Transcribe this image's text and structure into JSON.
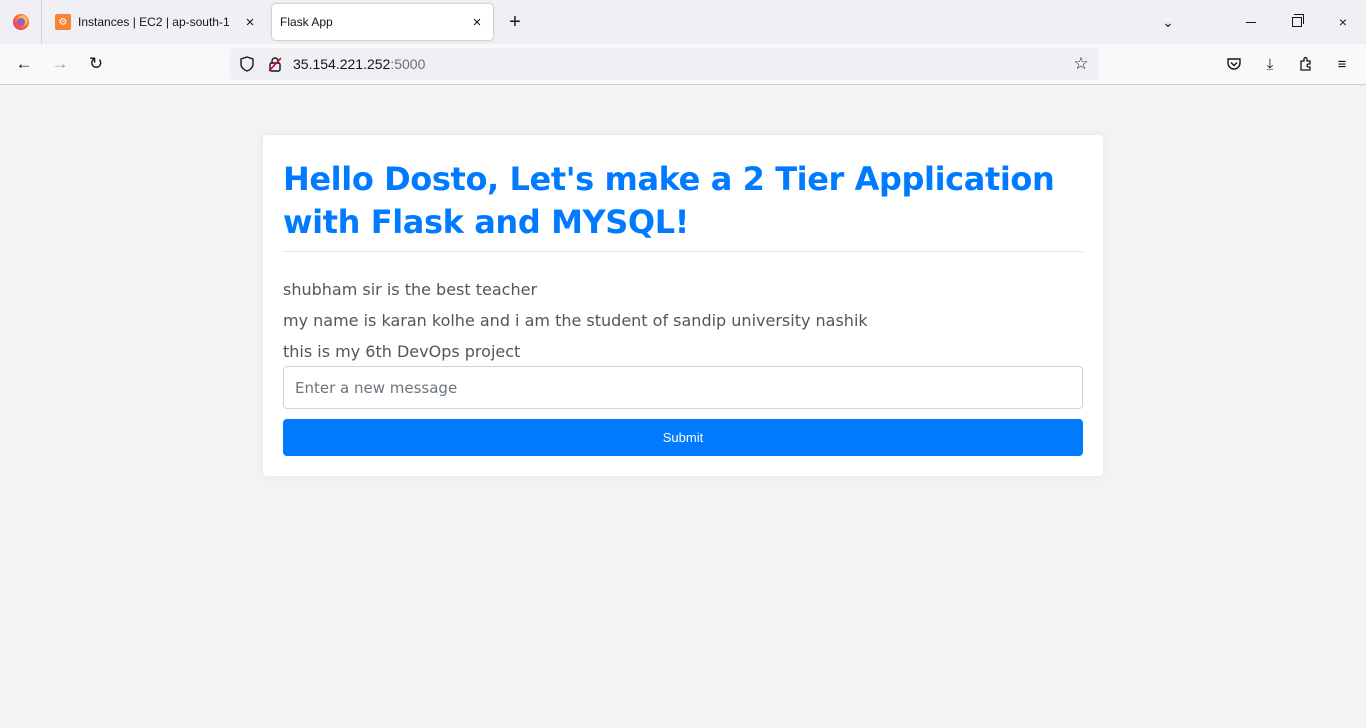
{
  "browser": {
    "tabs": [
      {
        "label": "Instances | EC2 | ap-south-1",
        "active": false
      },
      {
        "label": "Flask App",
        "active": true
      }
    ],
    "url_host": "35.154.221.252",
    "url_port": ":5000",
    "icons": {
      "close": "×",
      "new_tab": "+",
      "list_all": "⌄",
      "back": "←",
      "forward": "→",
      "reload": "↻",
      "star": "☆",
      "download": "⤓",
      "menu": "≡"
    }
  },
  "page": {
    "title": "Hello Dosto, Let's make a 2 Tier Application with Flask and MYSQL!",
    "messages": [
      "shubham sir is the best teacher",
      "my name is karan kolhe and i am the student of sandip university nashik",
      "this is my 6th DevOps project"
    ],
    "input_placeholder": "Enter a new message",
    "input_value": "",
    "submit_label": "Submit"
  },
  "colors": {
    "accent": "#007bff",
    "page_bg": "#f3f3f3",
    "card_bg": "#ffffff",
    "message_text": "#555555"
  }
}
